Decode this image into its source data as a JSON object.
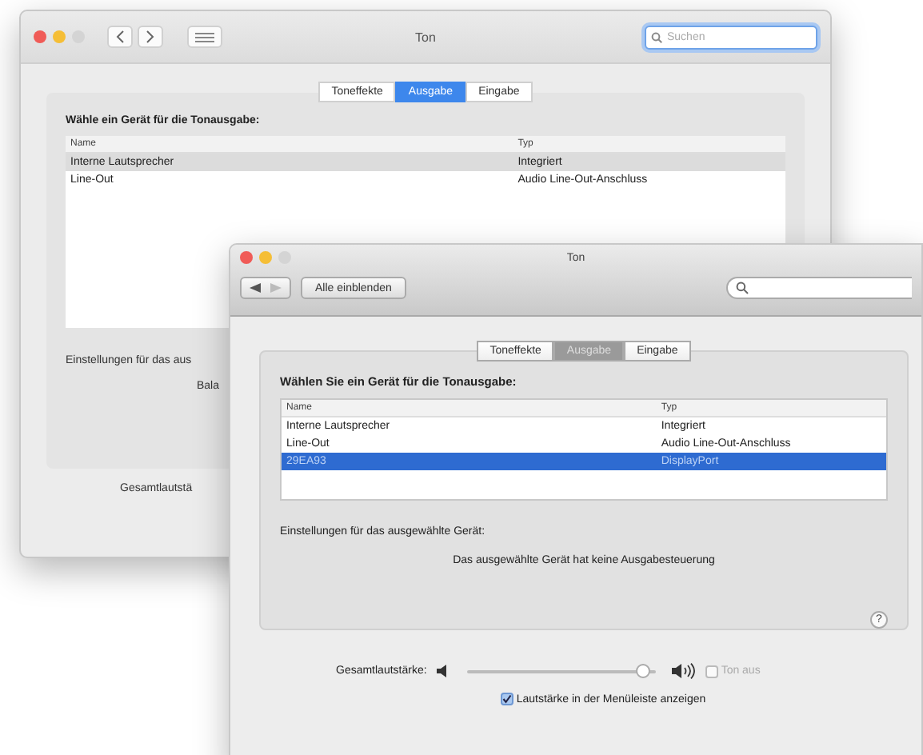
{
  "back_window": {
    "kind": "flat",
    "title": "Ton",
    "search": {
      "placeholder": "Suchen"
    },
    "tabs": [
      {
        "label": "Toneffekte",
        "selected": false
      },
      {
        "label": "Ausgabe",
        "selected": true
      },
      {
        "label": "Eingabe",
        "selected": false
      }
    ],
    "heading": "Wähle ein Gerät für die Tonausgabe:",
    "table": {
      "columns": [
        "Name",
        "Typ"
      ],
      "rows": [
        {
          "cells": [
            "Interne Lautsprecher",
            "Integriert"
          ],
          "selected": true
        },
        {
          "cells": [
            "Line-Out",
            "Audio Line-Out-Anschluss"
          ],
          "selected": false
        }
      ]
    },
    "settings_label": "Einstellungen für das aus",
    "balance_label": "Bala",
    "volume_label": "Gesamtlautstä"
  },
  "front_window": {
    "kind": "classic",
    "title": "Ton",
    "show_all_button": "Alle einblenden",
    "tabs": [
      {
        "label": "Toneffekte",
        "selected": false
      },
      {
        "label": "Ausgabe",
        "selected": true
      },
      {
        "label": "Eingabe",
        "selected": false
      }
    ],
    "heading": "Wählen Sie ein Gerät für die Tonausgabe:",
    "table": {
      "columns": [
        "Name",
        "Typ"
      ],
      "rows": [
        {
          "cells": [
            "Interne Lautsprecher",
            "Integriert"
          ],
          "selected": false
        },
        {
          "cells": [
            "Line-Out",
            "Audio Line-Out-Anschluss"
          ],
          "selected": false
        },
        {
          "cells": [
            "29EA93",
            "DisplayPort"
          ],
          "selected": true
        }
      ]
    },
    "settings_label": "Einstellungen für das ausgewählte Gerät:",
    "message": "Das ausgewählte Gerät hat keine Ausgabesteuerung",
    "help": "?",
    "volume": {
      "label": "Gesamtlautstärke:",
      "level": 0.93
    },
    "mute": {
      "label": "Ton aus",
      "checked": false
    },
    "menubar_checkbox": {
      "label": "Lautstärke in der Menüleiste anzeigen",
      "checked": true
    }
  }
}
